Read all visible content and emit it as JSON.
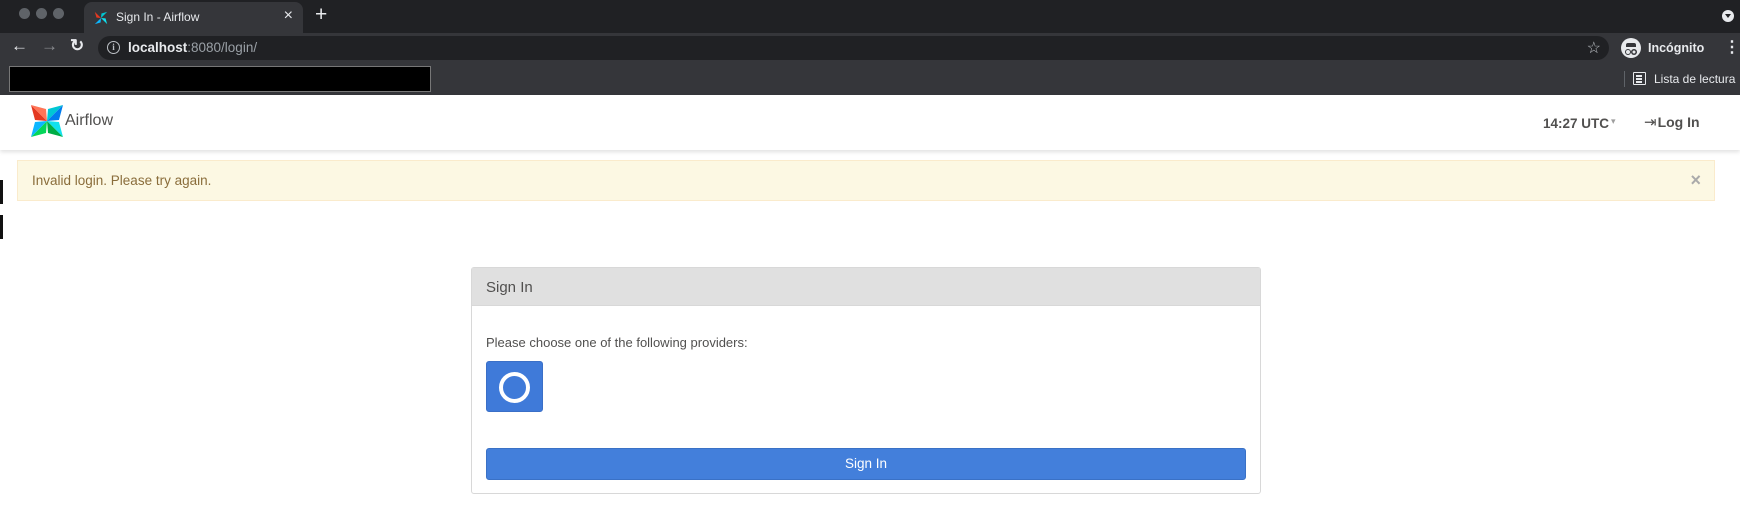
{
  "browser": {
    "tab_title": "Sign In - Airflow",
    "tab_close": "×",
    "new_tab": "+",
    "url_host": "localhost",
    "url_rest": ":8080/login/",
    "info_glyph": "i",
    "star_glyph": "☆",
    "incognito_label": "Incógnito",
    "menu_glyph": "⋮",
    "reading_list_label": "Lista de lectura",
    "back_glyph": "←",
    "forward_glyph": "→",
    "reload_glyph": "↻"
  },
  "navbar": {
    "brand": "Airflow",
    "clock": "14:27 UTC",
    "clock_caret": "▾",
    "login_icon": "⇥",
    "login_label": "Log In"
  },
  "alert": {
    "message": "Invalid login. Please try again.",
    "close": "×"
  },
  "signin_panel": {
    "title": "Sign In",
    "providers_text": "Please choose one of the following providers:",
    "submit_label": "Sign In"
  },
  "colors": {
    "primary": "#437fdb",
    "alert_bg": "#fcf8e3",
    "alert_text": "#8a6d3b",
    "chrome_dark": "#202124"
  },
  "icons": {
    "provider": "circle-provider-icon",
    "logo": "airflow-pinwheel-logo"
  }
}
